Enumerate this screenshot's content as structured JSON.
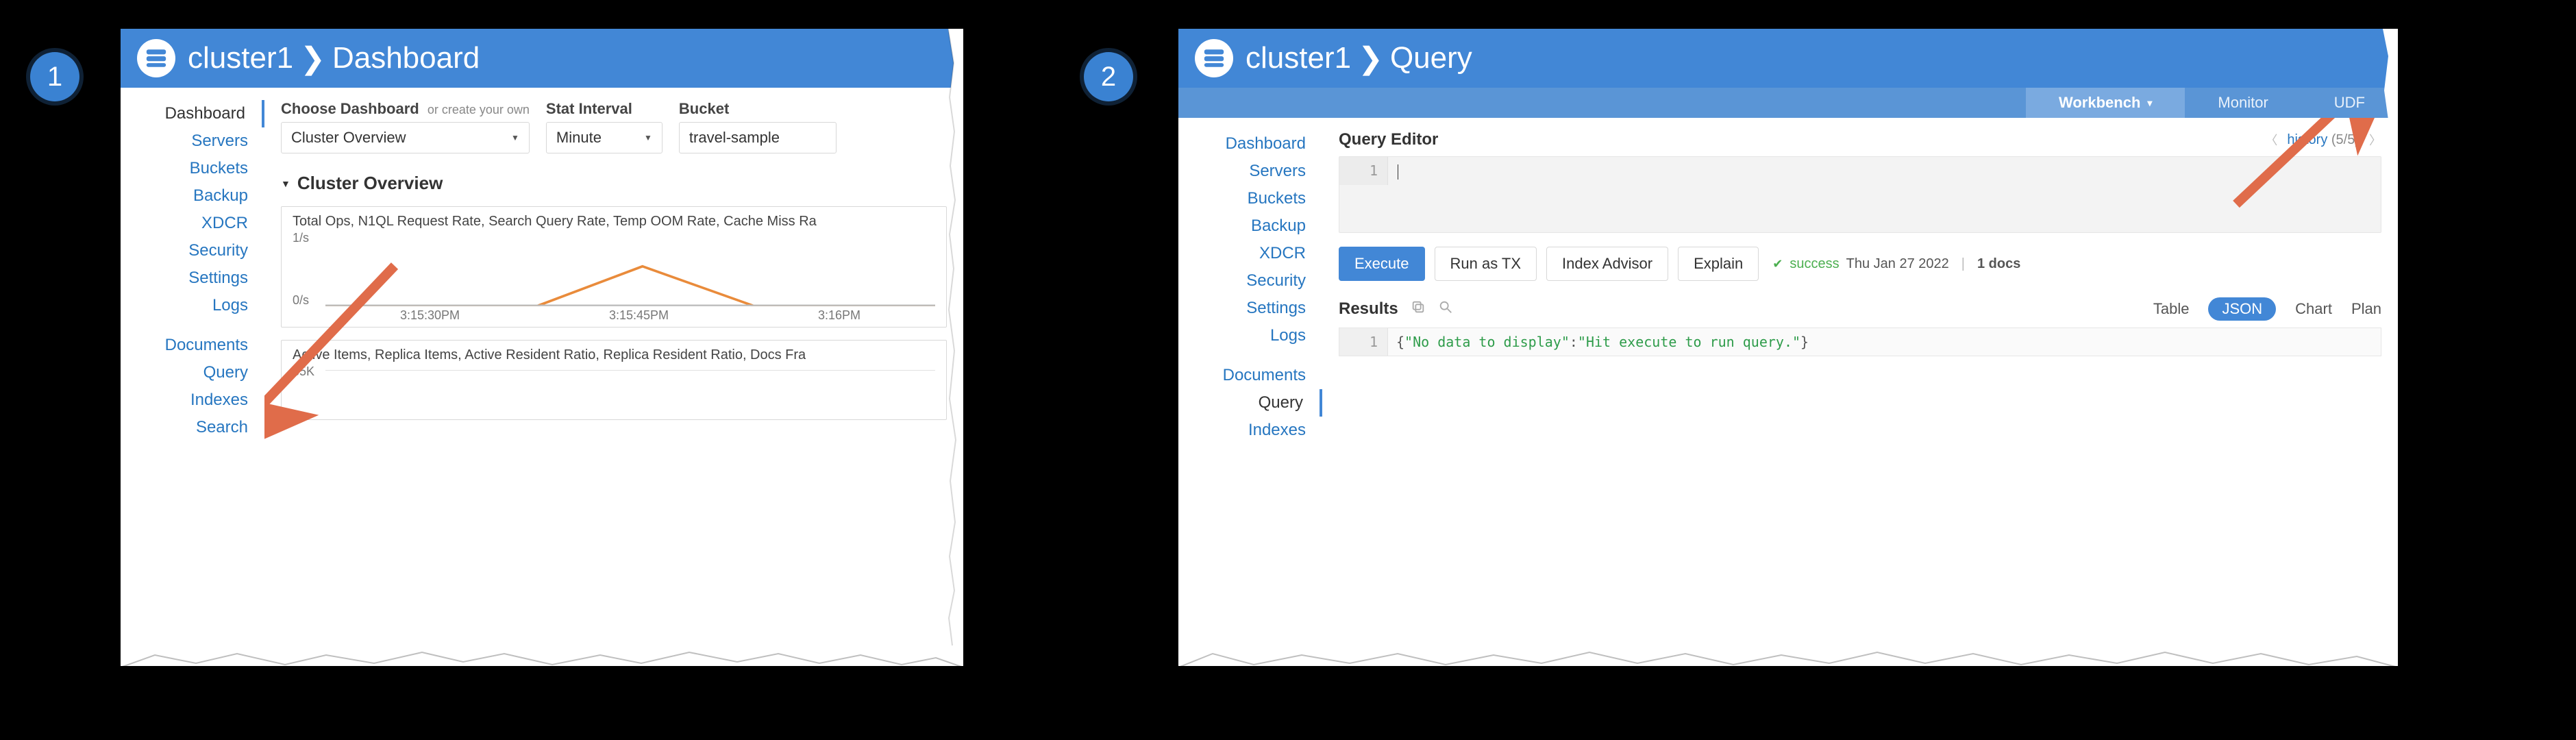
{
  "badges": {
    "step1": "1",
    "step2": "2"
  },
  "colors": {
    "header": "#4287d6",
    "subheader": "#5a95d6",
    "link": "#2676c0",
    "accent_arrow": "#e06c4a",
    "success": "#4caf50"
  },
  "panel1": {
    "header": {
      "cluster": "cluster1",
      "sep": "❯",
      "page": "Dashboard"
    },
    "sidebar": {
      "group1": [
        "Dashboard",
        "Servers",
        "Buckets",
        "Backup",
        "XDCR",
        "Security",
        "Settings",
        "Logs"
      ],
      "group2": [
        "Documents",
        "Query",
        "Indexes",
        "Search"
      ],
      "active": "Dashboard"
    },
    "controls": {
      "choose_label": "Choose Dashboard",
      "create_hint": "or create your own",
      "dashboard_value": "Cluster Overview",
      "interval_label": "Stat Interval",
      "interval_value": "Minute",
      "bucket_label": "Bucket",
      "bucket_value": "travel-sample"
    },
    "section_title": "Cluster Overview",
    "chart1": {
      "title": "Total Ops, N1QL Request Rate, Search Query Rate, Temp OOM Rate, Cache Miss Ra",
      "y_max": "1/s",
      "y_min": "0/s",
      "x_ticks": [
        "3:15:30PM",
        "3:15:45PM",
        "3:16PM"
      ]
    },
    "chart2": {
      "title": "Active Items, Replica Items, Active Resident Ratio, Replica Resident Ratio, Docs Fra",
      "y_max": "65K"
    }
  },
  "panel2": {
    "header": {
      "cluster": "cluster1",
      "sep": "❯",
      "page": "Query"
    },
    "subtabs": {
      "workbench": "Workbench",
      "monitor": "Monitor",
      "udf": "UDF",
      "active": "Workbench"
    },
    "sidebar": {
      "group1": [
        "Dashboard",
        "Servers",
        "Buckets",
        "Backup",
        "XDCR",
        "Security",
        "Settings",
        "Logs"
      ],
      "group2": [
        "Documents",
        "Query",
        "Indexes"
      ],
      "active": "Query"
    },
    "editor": {
      "title": "Query Editor",
      "history_label": "history",
      "history_count": "(5/5)",
      "line_no": "1"
    },
    "actions": {
      "execute": "Execute",
      "run_tx": "Run as TX",
      "index_advisor": "Index Advisor",
      "explain": "Explain"
    },
    "status": {
      "state": "success",
      "timestamp": "Thu Jan 27 2022",
      "docs": "1 docs"
    },
    "results": {
      "title": "Results",
      "tabs": {
        "table": "Table",
        "json": "JSON",
        "chart": "Chart",
        "plan": "Plan",
        "active": "JSON"
      },
      "line_no": "1",
      "json_key": "\"No data to display\"",
      "json_val": "\"Hit execute to run query.\""
    }
  },
  "chart_data": [
    {
      "type": "line",
      "title": "Total Ops, N1QL Request Rate, Search Query Rate, Temp OOM Rate, Cache Miss Ra",
      "xlabel": "",
      "ylabel": "",
      "ylim": [
        0,
        1
      ],
      "y_unit": "/s",
      "x": [
        "3:15:30PM",
        "3:15:45PM",
        "3:16PM"
      ],
      "series": [
        {
          "name": "orange",
          "color": "#e98b3b",
          "values": [
            0.0,
            0.55,
            0.0
          ]
        },
        {
          "name": "gray",
          "color": "#bdbdbd",
          "values": [
            0.0,
            0.0,
            0.0
          ]
        }
      ]
    },
    {
      "type": "line",
      "title": "Active Items, Replica Items, Active Resident Ratio, Replica Resident Ratio, Docs Fra",
      "xlabel": "",
      "ylabel": "",
      "ylim": [
        0,
        65000
      ],
      "x": [],
      "series": []
    }
  ]
}
